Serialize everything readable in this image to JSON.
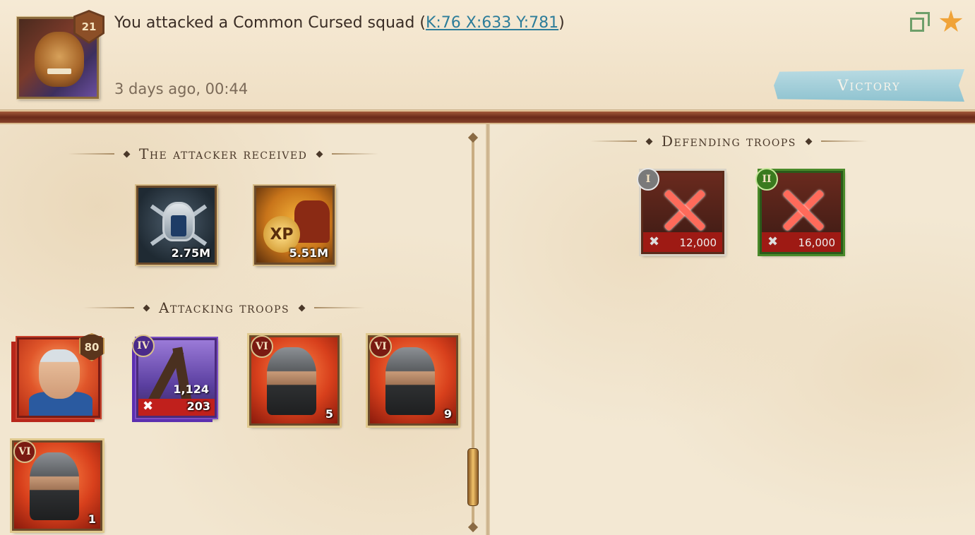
{
  "header": {
    "level": "21",
    "title_prefix": "You attacked a Common Cursed squad (",
    "coords_link": "K:76 X:633 Y:781",
    "title_suffix": ")",
    "timestamp": "3 days ago, 00:44",
    "result": "Victory"
  },
  "icons": {
    "copy": "copy-icon",
    "favorite": "star-icon",
    "star_color": "#f0a338"
  },
  "attacker_received": {
    "title": "The attacker received",
    "rewards": [
      {
        "icon": "honor-helmet-icon",
        "value": "2.75M"
      },
      {
        "icon": "xp-icon",
        "badge": "XP",
        "value": "5.51M"
      }
    ]
  },
  "attacking_troops": {
    "title": "Attacking troops",
    "hero": {
      "level": "80"
    },
    "units": [
      {
        "tier": "IV",
        "count": "1,124",
        "lost": "203"
      },
      {
        "tier": "VI",
        "count": "5"
      },
      {
        "tier": "VI",
        "count": "9"
      },
      {
        "tier": "VI",
        "count": "1"
      }
    ]
  },
  "defending_troops": {
    "title": "Defending troops",
    "units": [
      {
        "tier": "I",
        "count": "12,000"
      },
      {
        "tier": "II",
        "count": "16,000"
      }
    ]
  },
  "colors": {
    "victory_banner": "#a7d0da",
    "link": "#2d7d9a",
    "divider": "#7a2e1c"
  }
}
